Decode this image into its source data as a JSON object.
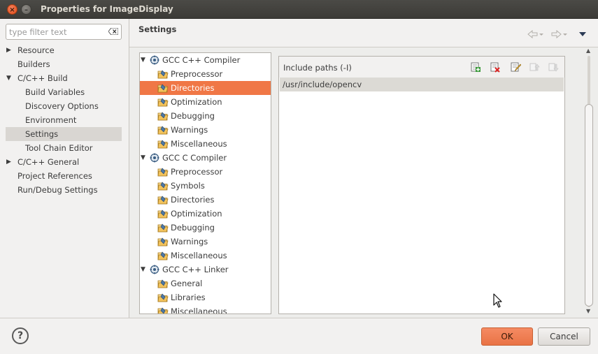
{
  "window": {
    "title": "Properties for ImageDisplay"
  },
  "filter": {
    "placeholder": "type filter text"
  },
  "sidebar": {
    "items": [
      {
        "label": "Resource",
        "arrow": "▶",
        "indent": 0
      },
      {
        "label": "Builders",
        "arrow": "",
        "indent": 0
      },
      {
        "label": "C/C++ Build",
        "arrow": "▼",
        "indent": 0
      },
      {
        "label": "Build Variables",
        "arrow": "",
        "indent": 1
      },
      {
        "label": "Discovery Options",
        "arrow": "",
        "indent": 1
      },
      {
        "label": "Environment",
        "arrow": "",
        "indent": 1
      },
      {
        "label": "Settings",
        "arrow": "",
        "indent": 1,
        "selected": true
      },
      {
        "label": "Tool Chain Editor",
        "arrow": "",
        "indent": 1
      },
      {
        "label": "C/C++ General",
        "arrow": "▶",
        "indent": 0
      },
      {
        "label": "Project References",
        "arrow": "",
        "indent": 0
      },
      {
        "label": "Run/Debug Settings",
        "arrow": "",
        "indent": 0
      }
    ]
  },
  "settings": {
    "title": "Settings"
  },
  "tool_tree": [
    {
      "type": "tool",
      "label": "GCC C++ Compiler"
    },
    {
      "type": "option",
      "label": "Preprocessor"
    },
    {
      "type": "option",
      "label": "Directories",
      "selected": true
    },
    {
      "type": "option",
      "label": "Optimization"
    },
    {
      "type": "option",
      "label": "Debugging"
    },
    {
      "type": "option",
      "label": "Warnings"
    },
    {
      "type": "option",
      "label": "Miscellaneous"
    },
    {
      "type": "tool",
      "label": "GCC C Compiler"
    },
    {
      "type": "option",
      "label": "Preprocessor"
    },
    {
      "type": "option",
      "label": "Symbols"
    },
    {
      "type": "option",
      "label": "Directories"
    },
    {
      "type": "option",
      "label": "Optimization"
    },
    {
      "type": "option",
      "label": "Debugging"
    },
    {
      "type": "option",
      "label": "Warnings"
    },
    {
      "type": "option",
      "label": "Miscellaneous"
    },
    {
      "type": "tool",
      "label": "GCC C++ Linker"
    },
    {
      "type": "option",
      "label": "General"
    },
    {
      "type": "option",
      "label": "Libraries"
    },
    {
      "type": "option",
      "label": "Miscellaneous"
    }
  ],
  "include_paths": {
    "title": "Include paths (-I)",
    "entries": [
      "/usr/include/opencv"
    ]
  },
  "buttons": {
    "ok": "OK",
    "cancel": "Cancel",
    "help": "?"
  },
  "colors": {
    "accent": "#f07746",
    "ok_button": "#e97345"
  }
}
